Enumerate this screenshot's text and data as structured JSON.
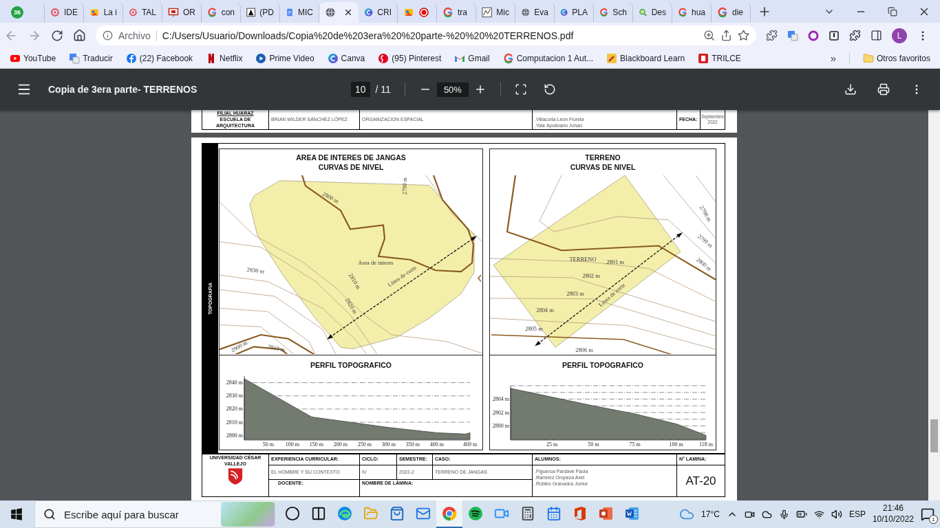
{
  "browser": {
    "tabs": [
      {
        "kind": "chat",
        "badge": "36",
        "selected": false
      },
      {
        "kind": "target",
        "label": "IDE",
        "selected": false
      },
      {
        "kind": "photo",
        "label": "La i",
        "selected": false
      },
      {
        "kind": "target",
        "label": "TAL",
        "selected": false
      },
      {
        "kind": "frame",
        "label": "OR",
        "selected": false
      },
      {
        "kind": "google",
        "label": "con",
        "selected": false
      },
      {
        "kind": "letter",
        "label": "(PD",
        "selected": false
      },
      {
        "kind": "doc",
        "label": "MIC",
        "selected": false
      },
      {
        "kind": "globe",
        "selected": true
      },
      {
        "kind": "design",
        "label": "CRI",
        "selected": false
      },
      {
        "kind": "pair",
        "selected": false
      },
      {
        "kind": "google",
        "label": "tra",
        "selected": false
      },
      {
        "kind": "sketch",
        "label": "Mic",
        "selected": false
      },
      {
        "kind": "globe",
        "label": "Eva",
        "selected": false
      },
      {
        "kind": "design",
        "label": "PLA",
        "selected": false
      },
      {
        "kind": "google",
        "label": "Sch",
        "selected": false
      },
      {
        "kind": "magnifier",
        "label": "Des",
        "selected": false
      },
      {
        "kind": "google",
        "label": "hua",
        "selected": false
      },
      {
        "kind": "google",
        "label": "die",
        "selected": false
      }
    ],
    "address": {
      "scheme": "Archivo",
      "url": "C:/Users/Usuario/Downloads/Copia%20de%203era%20%20parte-%20%20%20TERRENOS.pdf"
    },
    "profile": "L",
    "bookmarks": [
      {
        "kind": "video",
        "label": "YouTube"
      },
      {
        "kind": "translate",
        "label": "Traducir"
      },
      {
        "kind": "social",
        "label": "(22) Facebook"
      },
      {
        "kind": "stream",
        "label": "Netflix"
      },
      {
        "kind": "play",
        "label": "Prime Video"
      },
      {
        "kind": "design",
        "label": "Canva"
      },
      {
        "kind": "pin",
        "label": "(95) Pinterest"
      },
      {
        "kind": "mail",
        "label": "Gmail"
      },
      {
        "kind": "google",
        "label": "Computacion 1 Aut..."
      },
      {
        "kind": "pencil",
        "label": "Blackboard Learn"
      },
      {
        "kind": "shield",
        "label": "TRILCE"
      }
    ],
    "more_bookmarks": "»",
    "other_bookmarks": "Otros favoritos"
  },
  "pdf_viewer": {
    "title": "Copia de 3era parte- TERRENOS",
    "page": "10",
    "page_count": "/ 11",
    "zoom": "50%"
  },
  "previous_page": {
    "campus": "FILIAL HUARAZ",
    "school": "ESCUELA DE ARQUITECTURA",
    "teacher": "BRIAN WILDER SÁNCHEZ LÓPEZ",
    "sheet_name": "ORGANIZACION ESPACIAL",
    "students": [
      ".Villacorta Leon Fiorela",
      ".Yale Apolinario Johan"
    ],
    "date_label": "FECHA:",
    "date": "Septiembre 2022"
  },
  "sheet": {
    "side_label": "TOPOGRAFIA",
    "panels": [
      {
        "kind": "area",
        "title": [
          "AREA DE INTERES DE JANGAS",
          "CURVAS DE NIVEL"
        ],
        "labels": [
          "2800 m",
          "2790 m",
          "Area de interes",
          "2830 m",
          "2810 m",
          "2820 m",
          "Linea de corte",
          "2900 m",
          "2910 m"
        ],
        "chart_data": {
          "type": "area",
          "title": "PERFIL TOPOGRAFICO",
          "x": [
            0,
            140,
            200,
            300,
            400,
            460,
            469
          ],
          "series": [
            {
              "color": "#737a70",
              "values": [
                2843,
                2814,
                2811,
                2806,
                2802,
                2801,
                2802
              ]
            }
          ],
          "grid": true,
          "xlim": [
            0,
            469
          ],
          "ylim": [
            2797,
            2845
          ],
          "xticks": [
            {
              "value": 50,
              "label": "50 m"
            },
            {
              "value": 100,
              "label": "100 m"
            },
            {
              "value": 150,
              "label": "150 m"
            },
            {
              "value": 200,
              "label": "200 m"
            },
            {
              "value": 250,
              "label": "250 m"
            },
            {
              "value": 300,
              "label": "300 m"
            },
            {
              "value": 350,
              "label": "350 m"
            },
            {
              "value": 400,
              "label": "400 m"
            },
            {
              "value": 469,
              "label": "469 m"
            }
          ],
          "yticks": [
            {
              "value": 2800,
              "label": "2800 m"
            },
            {
              "value": 2810,
              "label": "2810 m"
            },
            {
              "value": 2820,
              "label": "2820 m"
            },
            {
              "value": 2830,
              "label": "2830 m"
            },
            {
              "value": 2840,
              "label": "2840 m"
            }
          ]
        }
      },
      {
        "kind": "terrain",
        "title": [
          "TERRENO",
          "CURVAS DE NIVEL"
        ],
        "labels": [
          "2798 m",
          "2799 m",
          "2800 m",
          "TERRENO",
          "2801 m",
          "2802 m",
          "2803 m",
          "2804 m",
          "2805 m",
          "2806 m",
          "Linea de corte"
        ],
        "chart_data": {
          "type": "area",
          "title": "PERFIL TOPOGRAFICO",
          "x": [
            0,
            25,
            50,
            75,
            100,
            118
          ],
          "series": [
            {
              "color": "#737a70",
              "values": [
                2805.6,
                2804.3,
                2803,
                2801.8,
                2800.3,
                2798.6
              ]
            }
          ],
          "grid": true,
          "xlim": [
            0,
            118
          ],
          "ylim": [
            2798,
            2806
          ],
          "xticks": [
            {
              "value": 25,
              "label": "25 m"
            },
            {
              "value": 50,
              "label": "50 m"
            },
            {
              "value": 75,
              "label": "75 m"
            },
            {
              "value": 100,
              "label": "100 m"
            },
            {
              "value": 118,
              "label": "118 m"
            }
          ],
          "yticks": [
            {
              "value": 2800,
              "label": "2800 m"
            },
            {
              "value": 2802,
              "label": "2802 m"
            },
            {
              "value": 2804,
              "label": "2804 m"
            }
          ]
        }
      }
    ],
    "title_block": {
      "university": "UNIVERSIDAD CÉSAR VALLEJO",
      "course_label": "EXPERIENCIA CURRICULAR:",
      "course": "EL HOMBRE Y SU CONTEXTO",
      "cycle_label": "CICLO:",
      "cycle": "IV",
      "semester_label": "SEMESTRE:",
      "semester": "2022-2",
      "case_label": "CASO:",
      "case": "TERRENO DE JANGAS",
      "students_label": "ALUMNOS:",
      "students": [
        ".Figueroa Pardavé Paola",
        ".Ramírez Oropeza Axel",
        ".Robles Granados Junior"
      ],
      "sheet_label": "N° LAMINA:",
      "sheet_number": "AT-20",
      "teacher_label": "DOCENTE:",
      "sheet_name_label": "NOMBRE DE LÁMINA:"
    }
  },
  "taskbar": {
    "search_placeholder": "Escribe aquí para buscar",
    "apps": [
      {
        "kind": "circle",
        "selected": false
      },
      {
        "kind": "task-view",
        "selected": false
      },
      {
        "kind": "swirl",
        "selected": false
      },
      {
        "kind": "folder",
        "selected": false
      },
      {
        "kind": "bag",
        "selected": false
      },
      {
        "kind": "mail",
        "selected": false
      },
      {
        "kind": "browser",
        "selected": true
      },
      {
        "kind": "waves",
        "selected": false
      },
      {
        "kind": "camera",
        "selected": false
      },
      {
        "kind": "calculator",
        "selected": false
      },
      {
        "kind": "calendar",
        "selected": false
      },
      {
        "kind": "office",
        "selected": false
      },
      {
        "kind": "slides",
        "selected": false
      },
      {
        "kind": "document",
        "selected": false
      }
    ],
    "temperature": "17°C",
    "language": "ESP",
    "time": "21:46",
    "date": "10/10/2022",
    "notifications": "1"
  }
}
